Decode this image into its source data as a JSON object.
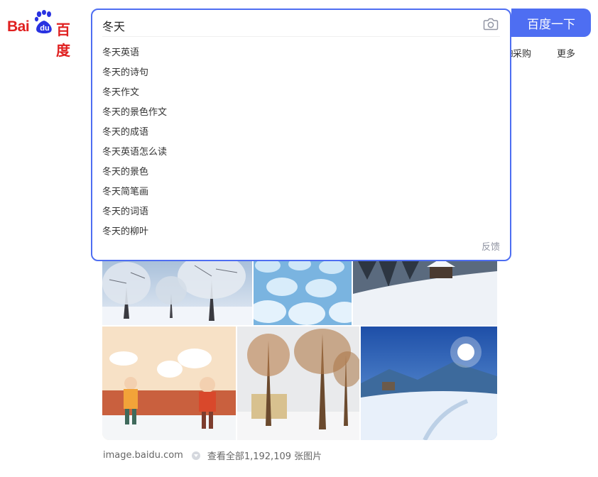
{
  "logo": {
    "part1": "Bai",
    "part2": "du",
    "part3": "百度"
  },
  "search": {
    "query": "冬天",
    "button_label": "百度一下",
    "suggestions": [
      "冬天英语",
      "冬天的诗句",
      "冬天作文",
      "冬天的景色作文",
      "冬天的成语",
      "冬天英语怎么读",
      "冬天的景色",
      "冬天简笔画",
      "冬天的词语",
      "冬天的柳叶"
    ],
    "feedback_label": "反馈"
  },
  "nav": {
    "procure_label": "采购",
    "procure_clipped": "的",
    "more_label": "更多"
  },
  "images": {
    "source": "image.baidu.com",
    "view_all": "查看全部1,192,109 张图片"
  },
  "colors": {
    "accent": "#4e6ef2",
    "logo_red": "#e02020",
    "logo_blue": "#2932e1"
  }
}
